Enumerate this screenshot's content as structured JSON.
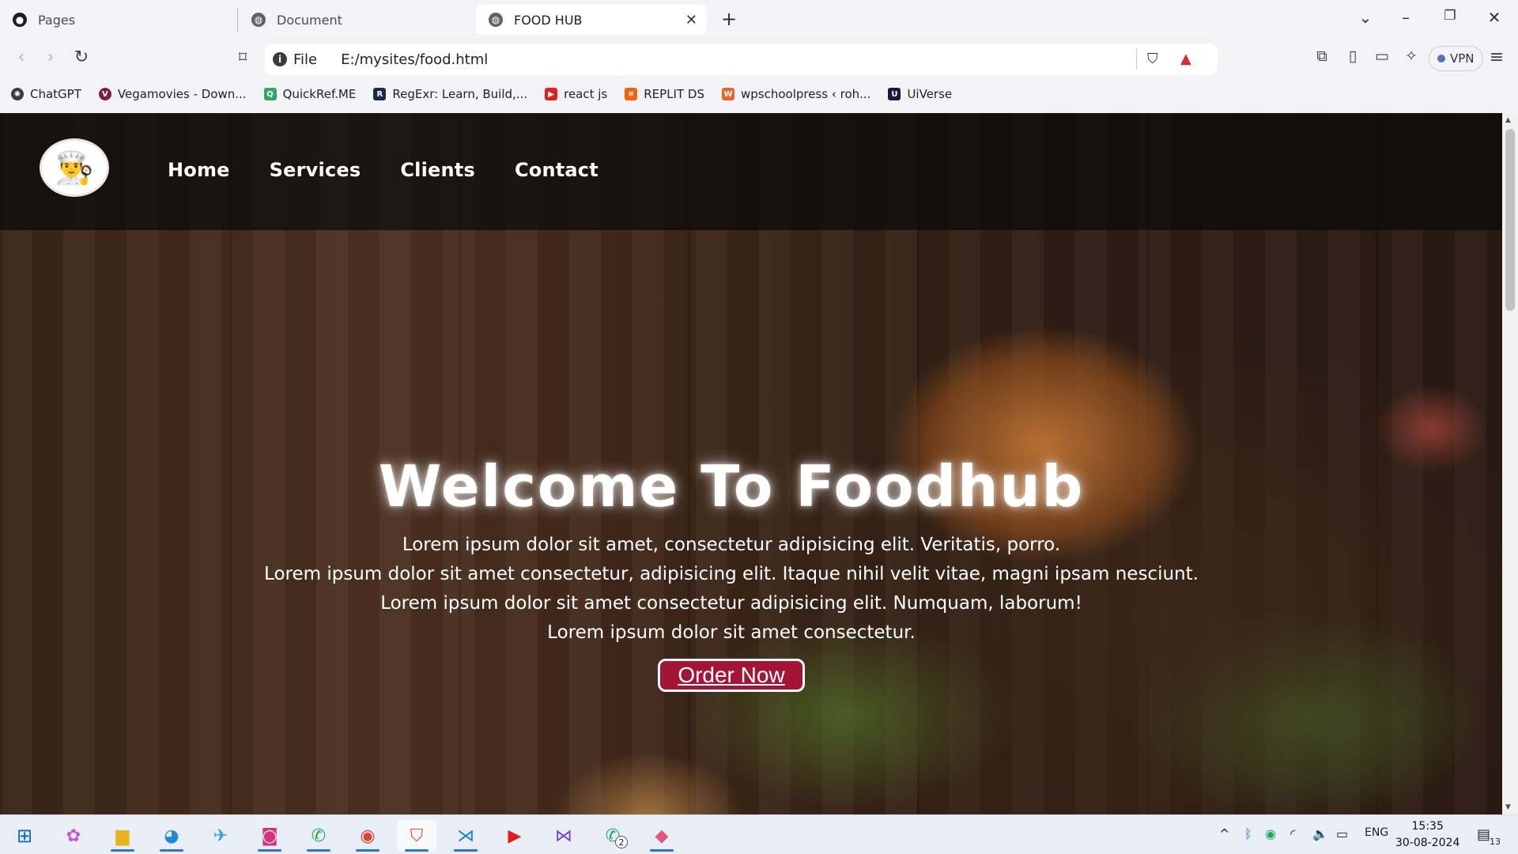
{
  "tabs": [
    {
      "label": "Pages",
      "icon": "github-icon"
    },
    {
      "label": "Document",
      "icon": "globe-icon"
    },
    {
      "label": "FOOD HUB",
      "icon": "globe-icon",
      "active": true
    }
  ],
  "address_bar": {
    "scheme_label": "File",
    "url": "E:/mysites/food.html"
  },
  "toolbar": {
    "vpn_label": "VPN"
  },
  "bookmarks": [
    {
      "label": "ChatGPT",
      "icon": "openai-icon"
    },
    {
      "label": "Vegamovies - Down...",
      "icon": "v-logo-icon"
    },
    {
      "label": "QuickRef.ME",
      "icon": "quickref-icon"
    },
    {
      "label": "RegExr: Learn, Build,...",
      "icon": "regexr-icon"
    },
    {
      "label": "react js",
      "icon": "youtube-icon"
    },
    {
      "label": "REPLIT DS",
      "icon": "replit-icon"
    },
    {
      "label": "wpschoolpress ‹ roh...",
      "icon": "wp-icon"
    },
    {
      "label": "UiVerse",
      "icon": "uiverse-icon"
    }
  ],
  "site": {
    "nav": [
      "Home",
      "Services",
      "Clients",
      "Contact"
    ],
    "hero": {
      "title": "Welcome To Foodhub",
      "lines": [
        "Lorem ipsum dolor sit amet, consectetur adipisicing elit. Veritatis, porro.",
        "Lorem ipsum dolor sit amet consectetur, adipisicing elit. Itaque nihil velit vitae, magni ipsam nesciunt.",
        "Lorem ipsum dolor sit amet consectetur adipisicing elit. Numquam, laborum!",
        "Lorem ipsum dolor sit amet consectetur."
      ],
      "button": "Order Now"
    }
  },
  "taskbar": {
    "apps": [
      "windows-start-icon",
      "copilot-icon",
      "file-explorer-icon",
      "edge-icon",
      "telegram-icon",
      "instagram-icon",
      "whatsapp-icon",
      "chrome-icon",
      "brave-icon",
      "vscode-icon",
      "youtube-music-icon",
      "visual-studio-icon",
      "whatsapp-business-icon",
      "git-icon"
    ],
    "whatsapp_badge": "2",
    "language": "ENG",
    "time": "15:35",
    "date": "30-08-2024",
    "notifications": "13"
  },
  "colors": {
    "order_button": "#a31535",
    "header_overlay": "#0a0a0a"
  }
}
